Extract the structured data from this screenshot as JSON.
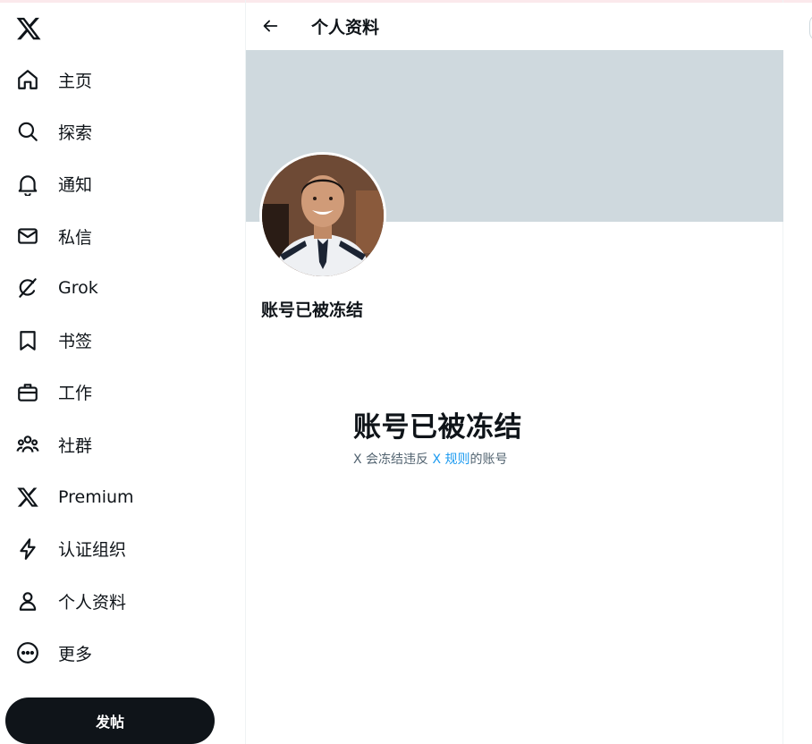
{
  "sidebar": {
    "logo_icon": "x-logo-icon",
    "items": [
      {
        "label": "主页",
        "icon": "home-icon"
      },
      {
        "label": "探索",
        "icon": "search-icon"
      },
      {
        "label": "通知",
        "icon": "bell-icon"
      },
      {
        "label": "私信",
        "icon": "mail-icon"
      },
      {
        "label": "Grok",
        "icon": "grok-icon"
      },
      {
        "label": "书签",
        "icon": "bookmark-icon"
      },
      {
        "label": "工作",
        "icon": "briefcase-icon"
      },
      {
        "label": "社群",
        "icon": "people-icon"
      },
      {
        "label": "Premium",
        "icon": "x-logo-icon"
      },
      {
        "label": "认证组织",
        "icon": "lightning-icon"
      },
      {
        "label": "个人资料",
        "icon": "person-icon"
      },
      {
        "label": "更多",
        "icon": "more-circle-icon"
      }
    ],
    "post_button": "发帖"
  },
  "header": {
    "back_icon": "arrow-left-icon",
    "title": "个人资料"
  },
  "profile": {
    "banner_color": "#cfd9de",
    "name": "账号已被冻结"
  },
  "notice": {
    "title": "账号已被冻结",
    "text_before": "X 会冻结违反 ",
    "link": "X 规则",
    "text_after": "的账号"
  },
  "colors": {
    "text": "#0f1419",
    "secondary": "#536471",
    "link": "#1d9bf0",
    "button_bg": "#0f1419"
  }
}
